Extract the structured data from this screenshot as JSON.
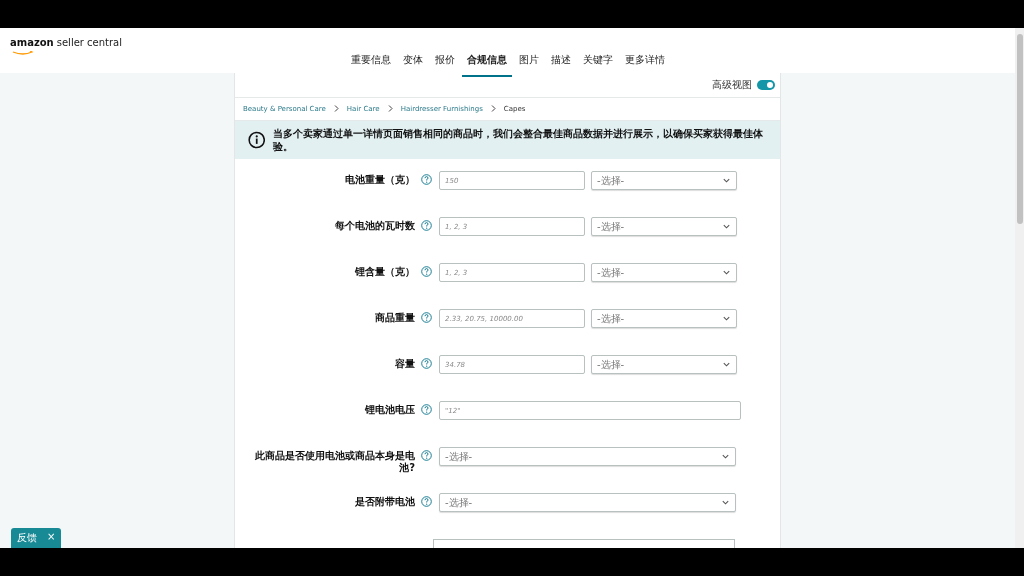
{
  "header": {
    "logo_brand": "amazon",
    "logo_product": "seller central"
  },
  "tabs": [
    {
      "label": "重要信息",
      "selected": false
    },
    {
      "label": "变体",
      "selected": false
    },
    {
      "label": "报价",
      "selected": false
    },
    {
      "label": "合规信息",
      "selected": true
    },
    {
      "label": "图片",
      "selected": false
    },
    {
      "label": "描述",
      "selected": false
    },
    {
      "label": "关键字",
      "selected": false
    },
    {
      "label": "更多详情",
      "selected": false
    }
  ],
  "advanced_view": {
    "label": "高级视图",
    "on": true
  },
  "breadcrumb": [
    "Beauty & Personal Care",
    "Hair Care",
    "Hairdresser Furnishings",
    "Capes"
  ],
  "notice": "当多个卖家通过单一详情页面销售相同的商品时，我们会整合最佳商品数据并进行展示，以确保买家获得最佳体验。",
  "fields": [
    {
      "kind": "value_unit",
      "label": "电池重量（克）",
      "placeholder": "150",
      "unit": "-选择-"
    },
    {
      "kind": "value_unit",
      "label": "每个电池的瓦时数",
      "placeholder": "1, 2, 3",
      "unit": "-选择-"
    },
    {
      "kind": "value_unit",
      "label": "锂含量（克）",
      "placeholder": "1, 2, 3",
      "unit": "-选择-"
    },
    {
      "kind": "value_unit",
      "label": "商品重量",
      "placeholder": "2.33, 20.75, 10000.00",
      "unit": "-选择-"
    },
    {
      "kind": "value_unit",
      "label": "容量",
      "placeholder": "34.78",
      "unit": "-选择-"
    },
    {
      "kind": "text",
      "label": "锂电池电压",
      "placeholder": "\"12\""
    },
    {
      "kind": "select",
      "label": "此商品是否使用电池或商品本身是电池?",
      "value": "-选择-"
    },
    {
      "kind": "select",
      "label": "是否附带电池",
      "value": "-选择-"
    }
  ],
  "feedback": {
    "label": "反馈",
    "close": "×"
  }
}
